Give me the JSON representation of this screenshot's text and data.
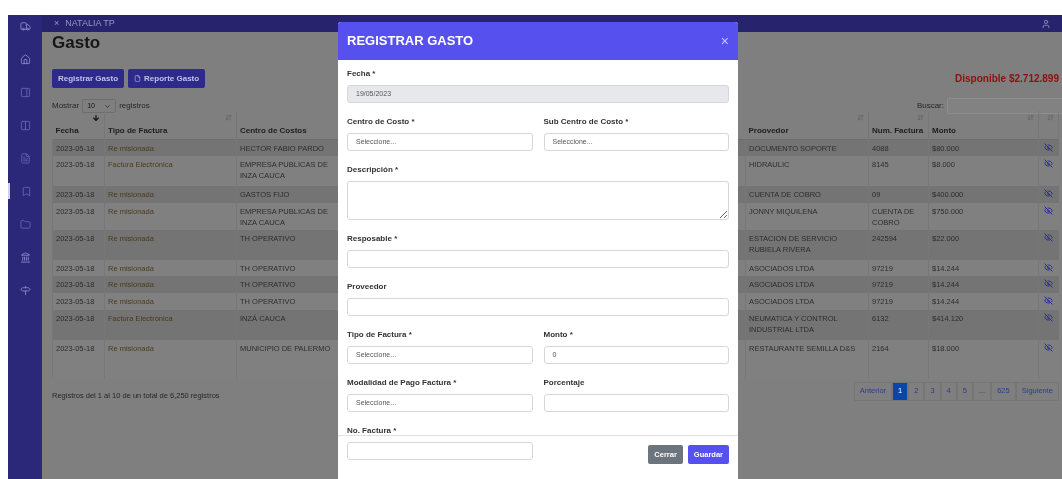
{
  "sidebar": {
    "items": [
      {
        "selected": false
      },
      {
        "selected": false
      },
      {
        "selected": false
      },
      {
        "selected": false
      },
      {
        "selected": false
      },
      {
        "selected": true
      },
      {
        "selected": false
      },
      {
        "selected": false
      },
      {
        "selected": false
      }
    ]
  },
  "topbar": {
    "close_glyph": "×",
    "user": "NATALIA TP"
  },
  "page": {
    "title": "Gasto",
    "buttons": [
      {
        "label": "Registrar Gasto",
        "kind": "plain"
      },
      {
        "label": "Reporte Gasto",
        "kind": "file"
      }
    ],
    "available": "Disponible $2.712.899",
    "length": {
      "prefix": "Mostrar",
      "value": "10",
      "suffix": "registros"
    },
    "search": {
      "label": "Buscar:"
    }
  },
  "table": {
    "columns": [
      {
        "label": "Fecha",
        "sorted": true
      },
      {
        "label": "Tipo de Factura",
        "sorted": false
      },
      {
        "label": "Centro de Costos"
      },
      {
        "label": "Proovedor",
        "sorted": false
      },
      {
        "label": "Num. Factura",
        "sorted": false
      },
      {
        "label": "Monto",
        "sorted": false
      },
      {
        "sorted": false
      }
    ],
    "rows": [
      [
        "2023-05-18",
        "Re misionada",
        "HECTOR FABIO PARDO",
        "DOCUMENTO SOPORTE",
        "4088",
        "$80.000"
      ],
      [
        "2023-05-18",
        "Factura Electrónica",
        "EMPRESA PUBLICAS DE INZA CAUCA",
        "HIDRAULIC",
        "8145",
        "$8.000"
      ],
      [
        "2023-05-18",
        "Re misionada",
        "GASTOS FIJO",
        "CUENTA DE COBRO",
        "09",
        "$400.000"
      ],
      [
        "2023-05-18",
        "Re misionada",
        "EMPRESA PUBLICAS DE INZA CAUCA",
        "JONNY MIQUILENA",
        "CUENTA DE COBRO",
        "$750.000"
      ],
      [
        "2023-05-18",
        "Re misionada",
        "TH OPERATIVO",
        "ESTACION DE SERVICIO RUBIELA RIVERA",
        "242594",
        "$22.000"
      ],
      [
        "2023-05-18",
        "Re misionada",
        "TH OPERATIVO",
        "ASOCIADOS LTDA",
        "97219",
        "$14.244"
      ],
      [
        "2023-05-18",
        "Re misionada",
        "TH OPERATIVO",
        "ASOCIADOS LTDA",
        "97219",
        "$14.244"
      ],
      [
        "2023-05-18",
        "Re misionada",
        "TH OPERATIVO",
        "ASOCIADOS LTDA",
        "97219",
        "$14.244"
      ],
      [
        "2023-05-18",
        "Factura Electrónica",
        "INZÁ CAUCA",
        "NEUMATICA Y CONTROL INDUSTRIAL LTDA",
        "6132",
        "$414.120"
      ],
      [
        "2023-05-18",
        "Re misionada",
        "MUNICIPIO DE PALERMO",
        "RESTAURANTE SEMILLA D&S",
        "2164",
        "$18.000"
      ]
    ],
    "info": "Registros del 1 al 10 de un total de 6,250 registros"
  },
  "pagination": [
    {
      "label": "Anterior",
      "selected": false
    },
    {
      "label": "1",
      "selected": true
    },
    {
      "label": "2",
      "selected": false
    },
    {
      "label": "3",
      "selected": false
    },
    {
      "label": "4",
      "selected": false
    },
    {
      "label": "5",
      "selected": false
    },
    {
      "label": "...",
      "selected": false
    },
    {
      "label": "625",
      "selected": false
    },
    {
      "label": "Siguiente",
      "selected": false
    }
  ],
  "modal": {
    "title": "REGISTRAR GASTO",
    "close_glyph": "×",
    "rows": [
      [
        {
          "label": "Fecha *",
          "kind": "input",
          "value": "19/05/2023",
          "disabled": true
        }
      ],
      [
        {
          "label": "Centro de Costo *",
          "kind": "select",
          "value": "Seleccione..."
        },
        {
          "label": "Sub Centro de Costo *",
          "kind": "select",
          "value": "Seleccione..."
        }
      ],
      [
        {
          "label": "Descripción *",
          "kind": "textarea"
        }
      ],
      [
        {
          "label": "Resposable *",
          "kind": "input",
          "disabled": false
        }
      ],
      [
        {
          "label": "Proveedor",
          "kind": "input",
          "disabled": false
        }
      ],
      [
        {
          "label": "Tipo de Factura *",
          "kind": "select",
          "value": "Seleccione..."
        },
        {
          "label": "Monto *",
          "kind": "input",
          "value": "0",
          "disabled": false
        }
      ],
      [
        {
          "label": "Modalidad de Pago Factura *",
          "kind": "select",
          "value": "Seleccione..."
        },
        {
          "label": "Porcentaje",
          "kind": "input",
          "disabled": false
        }
      ],
      [
        {
          "label": "No. Factura *",
          "kind": "input",
          "disabled": false
        }
      ]
    ],
    "buttons": [
      {
        "label": "Cerrar",
        "kind": "secondary"
      },
      {
        "label": "Guardar",
        "kind": "primary"
      }
    ]
  }
}
